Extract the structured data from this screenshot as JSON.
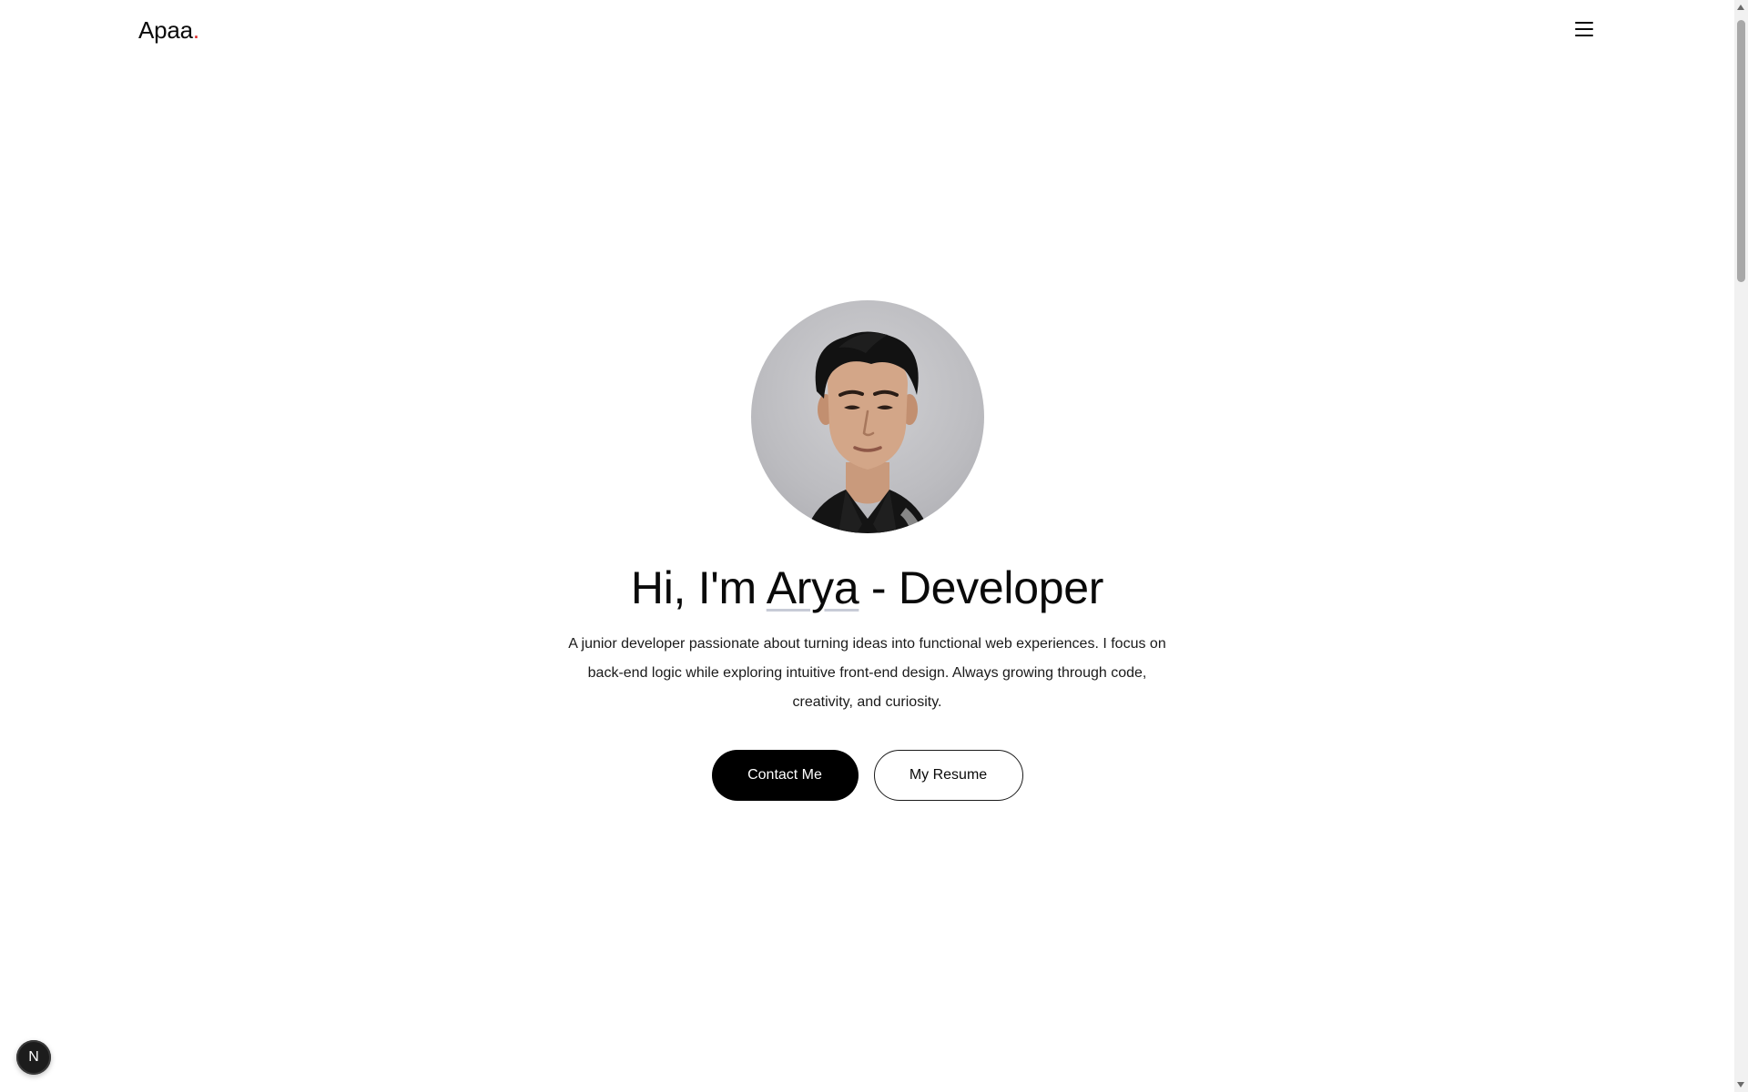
{
  "header": {
    "logo_text": "Apaa",
    "logo_dot": ".",
    "menu_icon": "hamburger-menu-icon"
  },
  "hero": {
    "avatar_alt": "profile-photo",
    "headline_prefix": "Hi, I'm ",
    "headline_name": "Arya",
    "headline_suffix": " - Developer",
    "bio": "A junior developer passionate about turning ideas into functional web experiences. I focus on back-end logic while exploring intuitive front-end design. Always growing through code, creativity, and curiosity.",
    "primary_button": "Contact Me",
    "secondary_button": "My Resume"
  },
  "dev_badge": {
    "label": "N"
  },
  "colors": {
    "accent_dot": "#dc2626",
    "primary_button_bg": "#000000",
    "text": "#0a0a0a",
    "name_underline": "#c7cbd6"
  }
}
